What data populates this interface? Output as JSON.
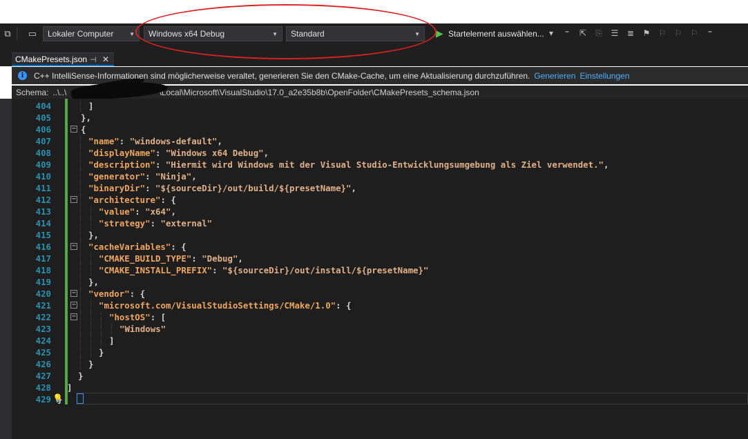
{
  "toolbar": {
    "target_computer": "Lokaler Computer",
    "configuration": "Windows x64 Debug",
    "preset": "Standard",
    "start_item": "Startelement auswählen..."
  },
  "tabs": [
    {
      "label": "CMakePresets.json"
    }
  ],
  "infobar": {
    "message": "C++ IntelliSense-Informationen sind möglicherweise veraltet, generieren Sie den CMake-Cache, um eine Aktualisierung durchzuführen.",
    "generate_link": "Generieren",
    "settings_link": "Einstellungen"
  },
  "schemabar": {
    "label": "Schema:",
    "path_start": "..\\..\\",
    "path_end": "\\Local\\Microsoft\\VisualStudio\\17.0_a2e35b8b\\OpenFolder\\CMakePresets_schema.json"
  },
  "code_lines": [
    {
      "n": "404",
      "t": "]"
    },
    {
      "n": "405",
      "t": "},"
    },
    {
      "n": "406",
      "t": "{"
    },
    {
      "n": "407",
      "k": "\"name\"",
      "t": ": ",
      "s": "\"windows-default\"",
      "e": ","
    },
    {
      "n": "408",
      "k": "\"displayName\"",
      "t": ": ",
      "s": "\"Windows x64 Debug\"",
      "e": ","
    },
    {
      "n": "409",
      "k": "\"description\"",
      "t": ": ",
      "s": "\"Hiermit wird Windows mit der Visual Studio-Entwicklungsumgebung als Ziel verwendet.\"",
      "e": ","
    },
    {
      "n": "410",
      "k": "\"generator\"",
      "t": ": ",
      "s": "\"Ninja\"",
      "e": ","
    },
    {
      "n": "411",
      "k": "\"binaryDir\"",
      "t": ": ",
      "s": "\"${sourceDir}/out/build/${presetName}\"",
      "e": ","
    },
    {
      "n": "412",
      "k": "\"architecture\"",
      "t": ": {"
    },
    {
      "n": "413",
      "k": "\"value\"",
      "t": ": ",
      "s": "\"x64\"",
      "e": ","
    },
    {
      "n": "414",
      "k": "\"strategy\"",
      "t": ": ",
      "s": "\"external\""
    },
    {
      "n": "415",
      "t": "},"
    },
    {
      "n": "416",
      "k": "\"cacheVariables\"",
      "t": ": {"
    },
    {
      "n": "417",
      "k": "\"CMAKE_BUILD_TYPE\"",
      "t": ": ",
      "s": "\"Debug\"",
      "e": ","
    },
    {
      "n": "418",
      "k": "\"CMAKE_INSTALL_PREFIX\"",
      "t": ": ",
      "s": "\"${sourceDir}/out/install/${presetName}\""
    },
    {
      "n": "419",
      "t": "},"
    },
    {
      "n": "420",
      "k": "\"vendor\"",
      "t": ": {"
    },
    {
      "n": "421",
      "k": "\"microsoft.com/VisualStudioSettings/CMake/1.0\"",
      "t": ": {"
    },
    {
      "n": "422",
      "k": "\"hostOS\"",
      "t": ": ["
    },
    {
      "n": "423",
      "s": "\"Windows\""
    },
    {
      "n": "424",
      "t": "]"
    },
    {
      "n": "425",
      "t": "}"
    },
    {
      "n": "426",
      "t": "}"
    },
    {
      "n": "427",
      "t": "}"
    },
    {
      "n": "428",
      "t": "]"
    },
    {
      "n": "429",
      "t": "}"
    }
  ],
  "colors": {
    "line_numbers": "#2b91af",
    "json_key": "#f0a65e",
    "json_string": "#e0b088",
    "change_bar": "#57a64a",
    "annotation": "#e02020"
  }
}
